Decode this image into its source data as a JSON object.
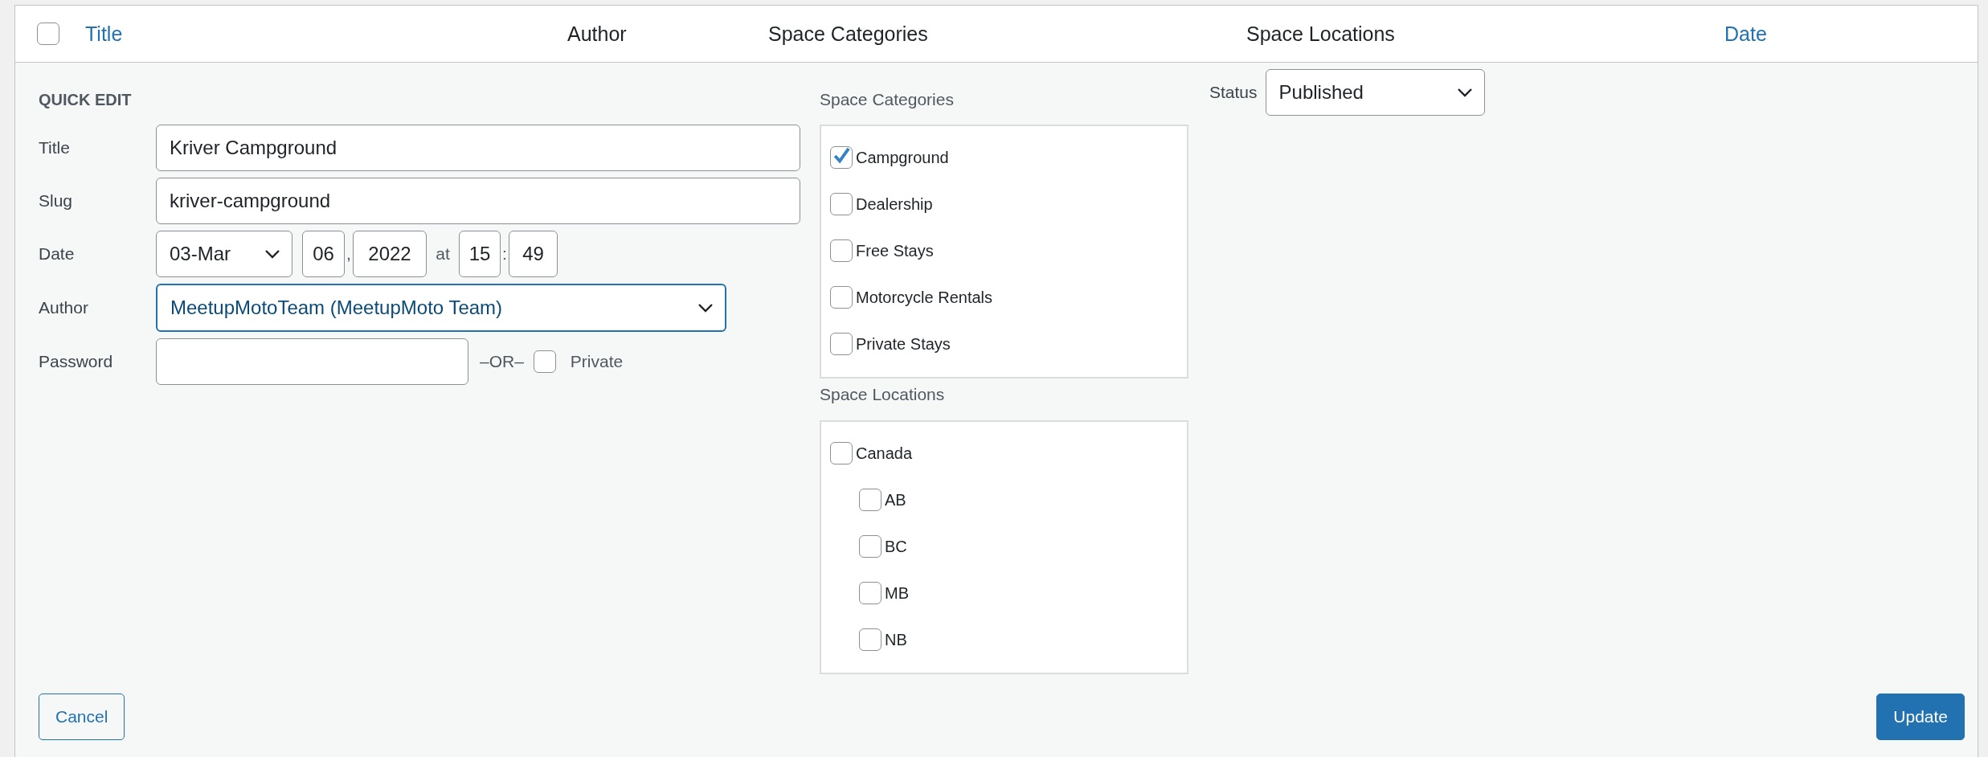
{
  "table": {
    "select_all": {
      "checked": false
    },
    "columns": [
      {
        "label": "Title",
        "sortable": true
      },
      {
        "label": "Author",
        "sortable": false
      },
      {
        "label": "Space Categories",
        "sortable": false
      },
      {
        "label": "Space Locations",
        "sortable": false
      },
      {
        "label": "Date",
        "sortable": true
      }
    ]
  },
  "quick_edit": {
    "heading": "QUICK EDIT",
    "title": {
      "label": "Title",
      "value": "Kriver Campground"
    },
    "slug": {
      "label": "Slug",
      "value": "kriver-campground"
    },
    "date": {
      "label": "Date",
      "month": "03-Mar",
      "day": "06",
      "day_sep": ",",
      "year": "2022",
      "at": "at",
      "hour": "15",
      "time_sep": ":",
      "minute": "49"
    },
    "author": {
      "label": "Author",
      "value": "MeetupMotoTeam (MeetupMoto Team)",
      "focused": true
    },
    "password": {
      "label": "Password",
      "or": "–OR–",
      "private_label": "Private",
      "private_checked": false
    },
    "categories": {
      "label": "Space Categories",
      "items": [
        {
          "label": "Campground",
          "checked": true
        },
        {
          "label": "Dealership",
          "checked": false
        },
        {
          "label": "Free Stays",
          "checked": false
        },
        {
          "label": "Motorcycle Rentals",
          "checked": false
        },
        {
          "label": "Private Stays",
          "checked": false
        }
      ]
    },
    "locations": {
      "label": "Space Locations",
      "items": [
        {
          "label": "Canada",
          "checked": false,
          "children": [
            {
              "label": "AB",
              "checked": false
            },
            {
              "label": "BC",
              "checked": false
            },
            {
              "label": "MB",
              "checked": false
            },
            {
              "label": "NB",
              "checked": false
            }
          ]
        }
      ]
    },
    "status": {
      "label": "Status",
      "value": "Published"
    },
    "buttons": [
      {
        "label": "Cancel",
        "kind": "secondary"
      },
      {
        "label": "Update",
        "kind": "primary"
      }
    ]
  }
}
